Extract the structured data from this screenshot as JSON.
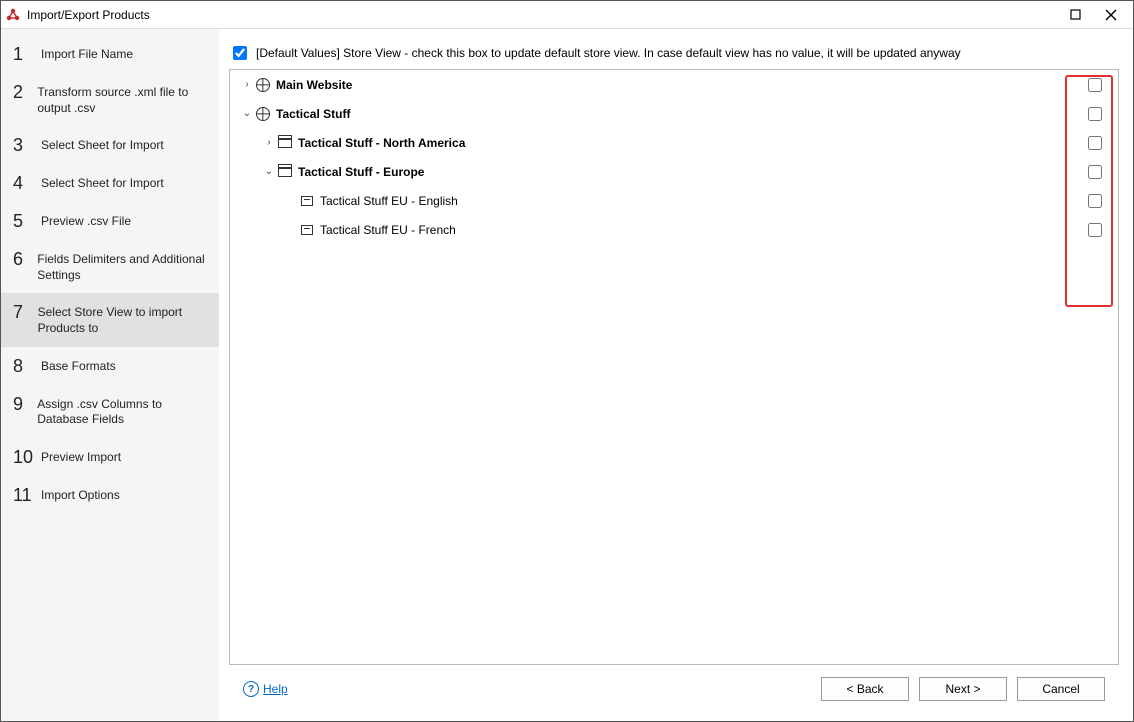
{
  "title": "Import/Export Products",
  "steps": [
    "Import File Name",
    "Transform source .xml file to output .csv",
    "Select Sheet for Import",
    "Select Sheet for Import",
    "Preview .csv File",
    "Fields Delimiters and Additional Settings",
    "Select Store View to import Products to",
    "Base Formats",
    "Assign .csv Columns to Database Fields",
    "Preview Import",
    "Import Options"
  ],
  "activeStep": 6,
  "defaultValuesLabel": "[Default Values] Store View - check this box to update default store view. In case default view has no value, it will be updated anyway",
  "tree": [
    {
      "indent": 0,
      "expand": "closed",
      "icon": "globe",
      "label": "Main Website",
      "bold": true
    },
    {
      "indent": 0,
      "expand": "open",
      "icon": "globe",
      "label": "Tactical Stuff",
      "bold": true
    },
    {
      "indent": 1,
      "expand": "closed",
      "icon": "store",
      "label": "Tactical Stuff - North America",
      "bold": true
    },
    {
      "indent": 1,
      "expand": "open",
      "icon": "store",
      "label": "Tactical Stuff - Europe",
      "bold": true
    },
    {
      "indent": 2,
      "expand": "none",
      "icon": "view",
      "label": "Tactical Stuff EU - English",
      "bold": false
    },
    {
      "indent": 2,
      "expand": "none",
      "icon": "view",
      "label": "Tactical Stuff EU - French",
      "bold": false
    }
  ],
  "help": "Help",
  "buttons": {
    "back": "< Back",
    "next": "Next >",
    "cancel": "Cancel"
  }
}
